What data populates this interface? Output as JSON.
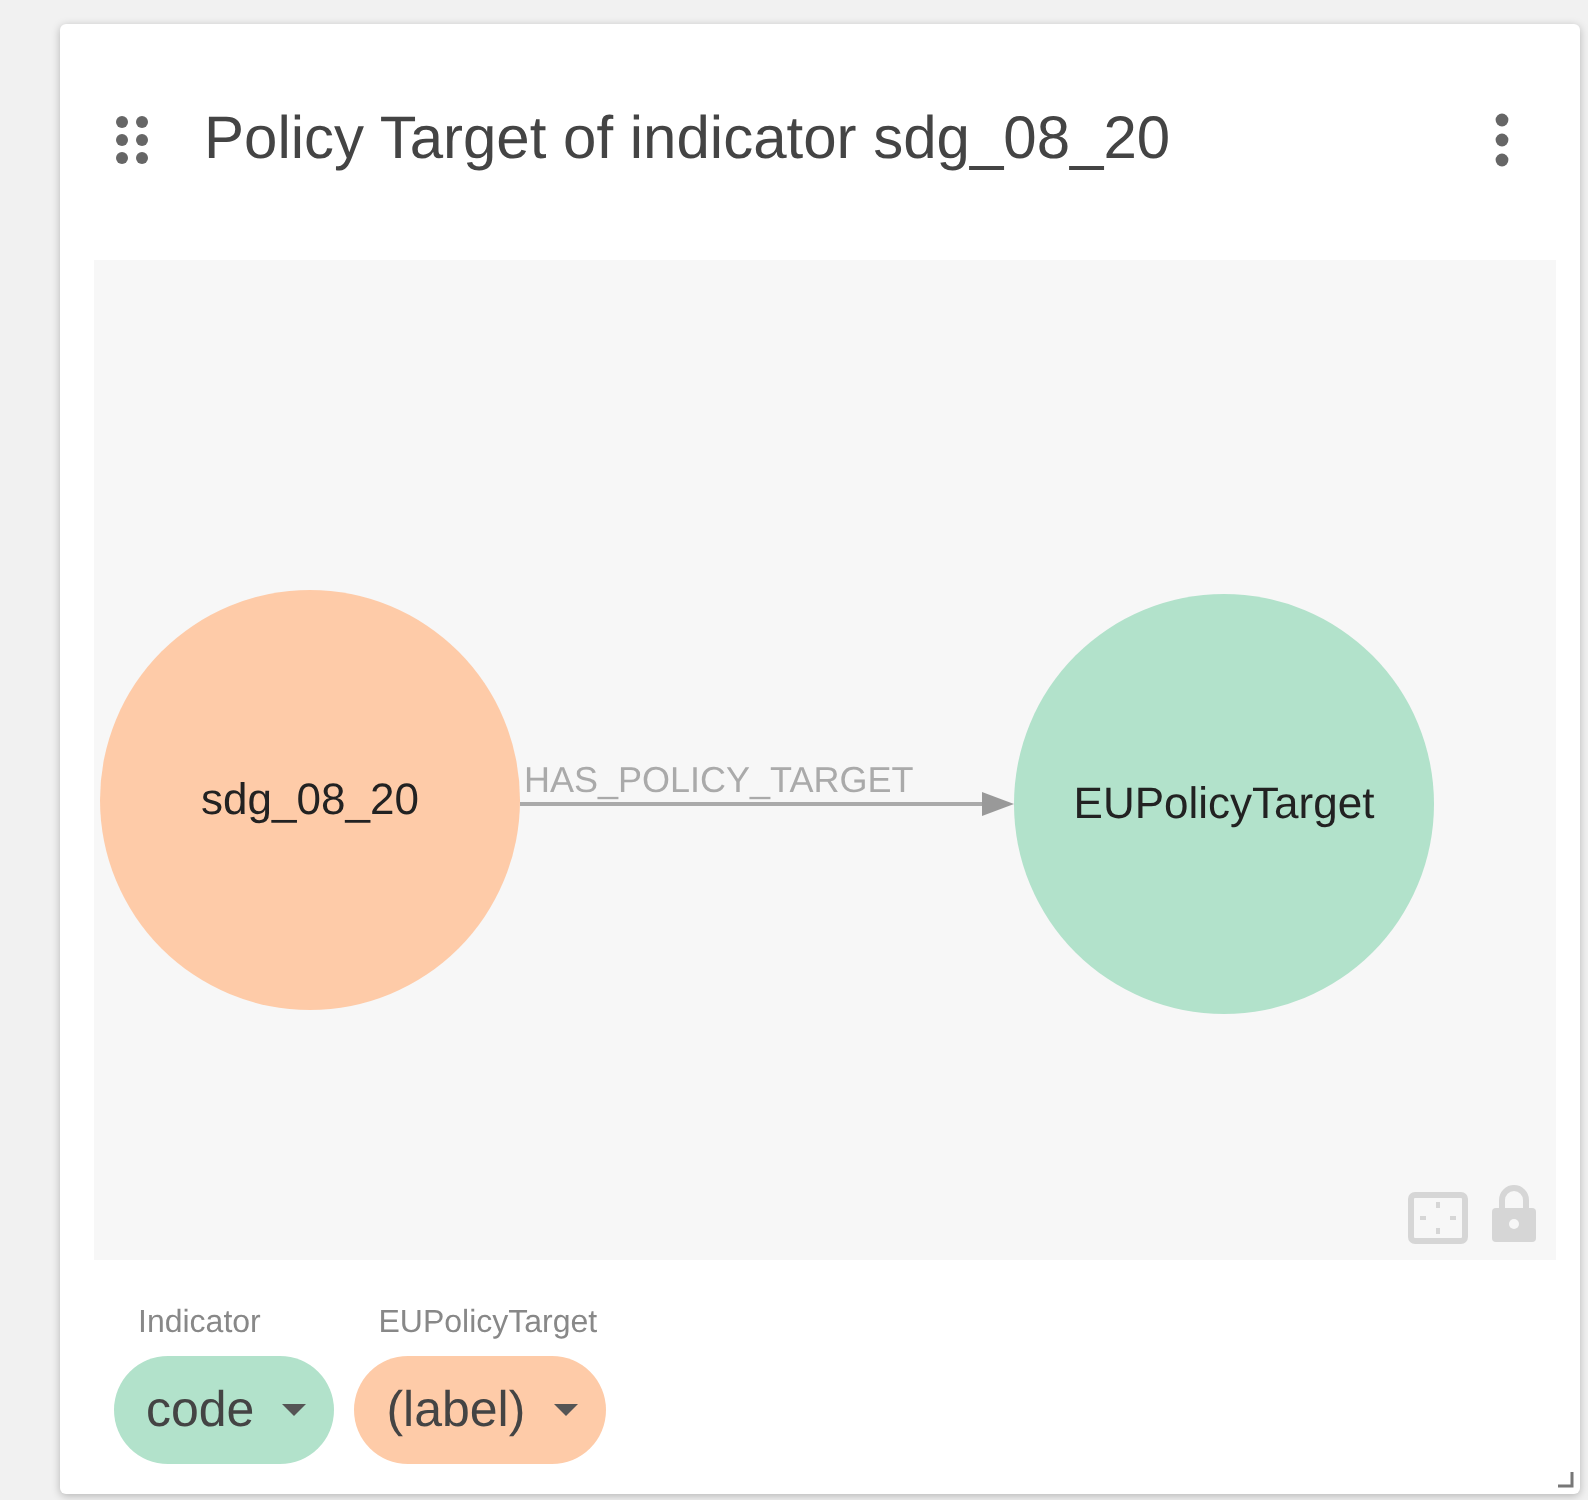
{
  "card": {
    "title": "Policy Target of indicator sdg_08_20"
  },
  "graph": {
    "nodes": [
      {
        "label": "sdg_08_20",
        "color": "#fecba8"
      },
      {
        "label": "EUPolicyTarget",
        "color": "#b2e2cb"
      }
    ],
    "edges": [
      {
        "label": "HAS_POLICY_TARGET"
      }
    ]
  },
  "legend": [
    {
      "category": "Indicator",
      "property": "code",
      "color": "#b2e2cb"
    },
    {
      "category": "EUPolicyTarget",
      "property": "(label)",
      "color": "#fecba8"
    }
  ]
}
